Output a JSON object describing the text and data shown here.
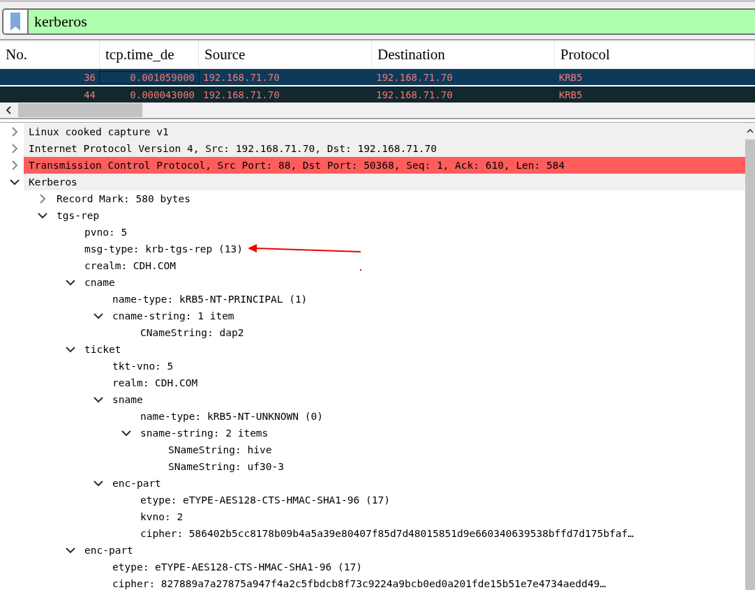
{
  "filter": {
    "value": "kerberos"
  },
  "packet_list": {
    "columns": [
      "No.",
      "tcp.time_de",
      "Source",
      "Destination",
      "Protocol"
    ],
    "rows": [
      {
        "cells": [
          "36",
          "0.001059000",
          "192.168.71.70",
          "192.168.71.70",
          "KRB5"
        ],
        "selected": true
      },
      {
        "cells": [
          "44",
          "0.000043000",
          "192.168.71.70",
          "192.168.71.70",
          "KRB5"
        ],
        "selected": false
      }
    ]
  },
  "details_tree": [
    {
      "label": "Linux cooked capture v1",
      "expanded": false,
      "color": "#f0f0f0"
    },
    {
      "label": "Internet Protocol Version 4, Src: 192.168.71.70, Dst: 192.168.71.70",
      "expanded": false,
      "color": "#f0f0f0"
    },
    {
      "label": "Transmission Control Protocol, Src Port: 88, Dst Port: 50368, Seq: 1, Ack: 610, Len: 584",
      "expanded": false,
      "color": "#ff5c5c"
    },
    {
      "label": "Kerberos",
      "expanded": true,
      "color": "#f0f0f0",
      "children": [
        {
          "label": "Record Mark: 580 bytes",
          "expanded": false
        },
        {
          "label": "tgs-rep",
          "expanded": true,
          "children": [
            {
              "label": "pvno: 5"
            },
            {
              "label": "msg-type: krb-tgs-rep (13)"
            },
            {
              "label": "crealm: CDH.COM"
            },
            {
              "label": "cname",
              "expanded": true,
              "children": [
                {
                  "label": "name-type: kRB5-NT-PRINCIPAL (1)"
                },
                {
                  "label": "cname-string: 1 item",
                  "expanded": true,
                  "children": [
                    {
                      "label": "CNameString: dap2"
                    }
                  ]
                }
              ]
            },
            {
              "label": "ticket",
              "expanded": true,
              "children": [
                {
                  "label": "tkt-vno: 5"
                },
                {
                  "label": "realm: CDH.COM"
                },
                {
                  "label": "sname",
                  "expanded": true,
                  "children": [
                    {
                      "label": "name-type: kRB5-NT-UNKNOWN (0)"
                    },
                    {
                      "label": "sname-string: 2 items",
                      "expanded": true,
                      "children": [
                        {
                          "label": "SNameString: hive"
                        },
                        {
                          "label": "SNameString: uf30-3"
                        }
                      ]
                    }
                  ]
                },
                {
                  "label": "enc-part",
                  "expanded": true,
                  "children": [
                    {
                      "label": "etype: eTYPE-AES128-CTS-HMAC-SHA1-96 (17)"
                    },
                    {
                      "label": "kvno: 2"
                    },
                    {
                      "label": "cipher: 586402b5cc8178b09b4a5a39e80407f85d7d48015851d9e660340639538bffd7d175bfaf…"
                    }
                  ]
                }
              ]
            },
            {
              "label": "enc-part",
              "expanded": true,
              "children": [
                {
                  "label": "etype: eTYPE-AES128-CTS-HMAC-SHA1-96 (17)"
                },
                {
                  "label": "cipher: 827889a7a27875a947f4a2c5fbdcb8f73c9224a9bcb0ed0a201fde15b51e7e4734aedd49…"
                }
              ]
            }
          ]
        }
      ]
    }
  ]
}
